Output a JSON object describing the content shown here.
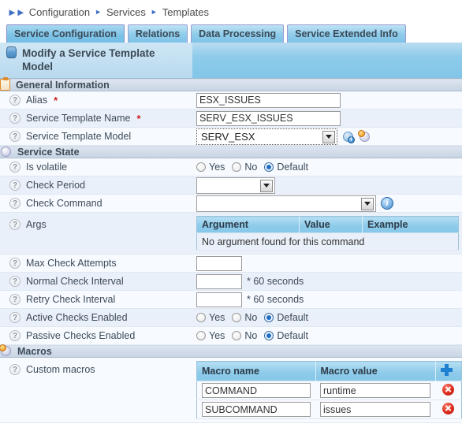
{
  "breadcrumb": {
    "lead_icon": "double-chevron-icon",
    "items": [
      "Configuration",
      "Services",
      "Templates"
    ]
  },
  "tabs": [
    {
      "label": "Service Configuration",
      "active": true
    },
    {
      "label": "Relations",
      "active": false
    },
    {
      "label": "Data Processing",
      "active": false
    },
    {
      "label": "Service Extended Info",
      "active": false
    }
  ],
  "panel": {
    "title": "Modify a Service Template Model",
    "title_icon": "database-icon"
  },
  "sections": {
    "general": {
      "title": "General Information",
      "icon": "clipboard-icon",
      "fields": {
        "alias": {
          "label": "Alias",
          "required": true,
          "value": "ESX_ISSUES"
        },
        "template_name": {
          "label": "Service Template Name",
          "required": true,
          "value": "SERV_ESX_ISSUES"
        },
        "template_model": {
          "label": "Service Template Model",
          "required": false,
          "value": "SERV_ESX",
          "icons": [
            "gear-info-icon",
            "gear-alert-icon"
          ]
        }
      }
    },
    "service_state": {
      "title": "Service State",
      "icon": "gear-icon",
      "fields": {
        "is_volatile": {
          "label": "Is volatile",
          "options": [
            "Yes",
            "No",
            "Default"
          ],
          "selected": "Default"
        },
        "check_period": {
          "label": "Check Period",
          "value": ""
        },
        "check_command": {
          "label": "Check Command",
          "value": "",
          "icon": "info-icon"
        },
        "args": {
          "label": "Args",
          "columns": [
            "Argument",
            "Value",
            "Example"
          ],
          "empty_message": "No argument found for this command",
          "rows": []
        },
        "max_check_attempts": {
          "label": "Max Check Attempts",
          "value": ""
        },
        "normal_check_interval": {
          "label": "Normal Check Interval",
          "value": "",
          "suffix": "* 60 seconds"
        },
        "retry_check_interval": {
          "label": "Retry Check Interval",
          "value": "",
          "suffix": "* 60 seconds"
        },
        "active_checks_enabled": {
          "label": "Active Checks Enabled",
          "options": [
            "Yes",
            "No",
            "Default"
          ],
          "selected": "Default"
        },
        "passive_checks_enabled": {
          "label": "Passive Checks Enabled",
          "options": [
            "Yes",
            "No",
            "Default"
          ],
          "selected": "Default"
        }
      }
    },
    "macros": {
      "title": "Macros",
      "icon": "gear-orange-icon",
      "custom_macros": {
        "label": "Custom macros",
        "columns": [
          "Macro name",
          "Macro value"
        ],
        "add_icon": "plus-icon",
        "rows": [
          {
            "name": "COMMAND",
            "value": "runtime",
            "delete_icon": "delete-icon"
          },
          {
            "name": "SUBCOMMAND",
            "value": "issues",
            "delete_icon": "delete-icon"
          }
        ]
      }
    }
  },
  "colors": {
    "tab_blue": "#8ecbea",
    "grid_header_blue": "#8ecbea",
    "row_odd": "#f7faff",
    "row_even": "#eaf0fa",
    "required_red": "#d12020",
    "accent_plus": "#1f7fd0",
    "delete_red": "#de2b1c"
  },
  "help_icon_glyph": "?"
}
